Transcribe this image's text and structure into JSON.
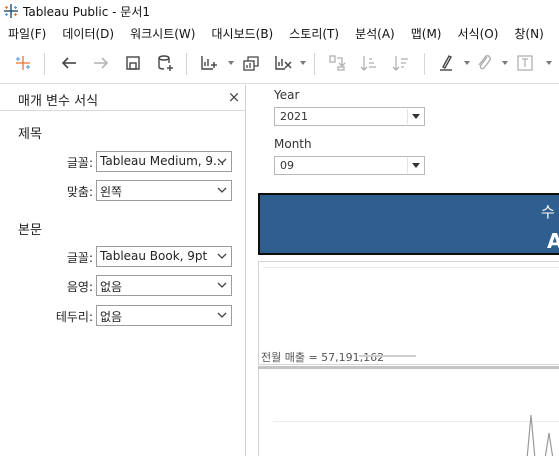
{
  "window": {
    "title": "Tableau Public - 문서1"
  },
  "menu": [
    "파일(F)",
    "데이터(D)",
    "워크시트(W)",
    "대시보드(B)",
    "스토리(T)",
    "분석(A)",
    "맵(M)",
    "서식(O)",
    "창(N)"
  ],
  "toolbar": {
    "icons": [
      "tableau-logo-icon",
      "undo-icon",
      "redo-icon",
      "save-icon",
      "new-data-source-icon",
      "new-worksheet-icon",
      "duplicate-sheet-icon",
      "clear-sheet-icon",
      "swap-icon",
      "sort-ascending-icon",
      "sort-descending-icon",
      "highlight-icon",
      "group-icon",
      "labels-icon"
    ]
  },
  "format_pane": {
    "title": "매개 변수 서식",
    "close": "×",
    "title_section": {
      "heading": "제목",
      "font_label": "글꼴:",
      "font_value": "Tableau Medium, 9...",
      "align_label": "맞춤:",
      "align_value": "왼쪽"
    },
    "body_section": {
      "heading": "본문",
      "font_label": "글꼴:",
      "font_value": "Tableau Book, 9pt",
      "shading_label": "음영:",
      "shading_value": "없음",
      "border_label": "테두리:",
      "border_value": "없음"
    }
  },
  "canvas": {
    "filter_year": {
      "label": "Year",
      "value": "2021"
    },
    "filter_month": {
      "label": "Month",
      "value": "09"
    },
    "banner": {
      "text": "수",
      "mark": "A",
      "color": "#2f5f8f"
    },
    "kpi_text": "전월 매출 = 57,191,162"
  }
}
